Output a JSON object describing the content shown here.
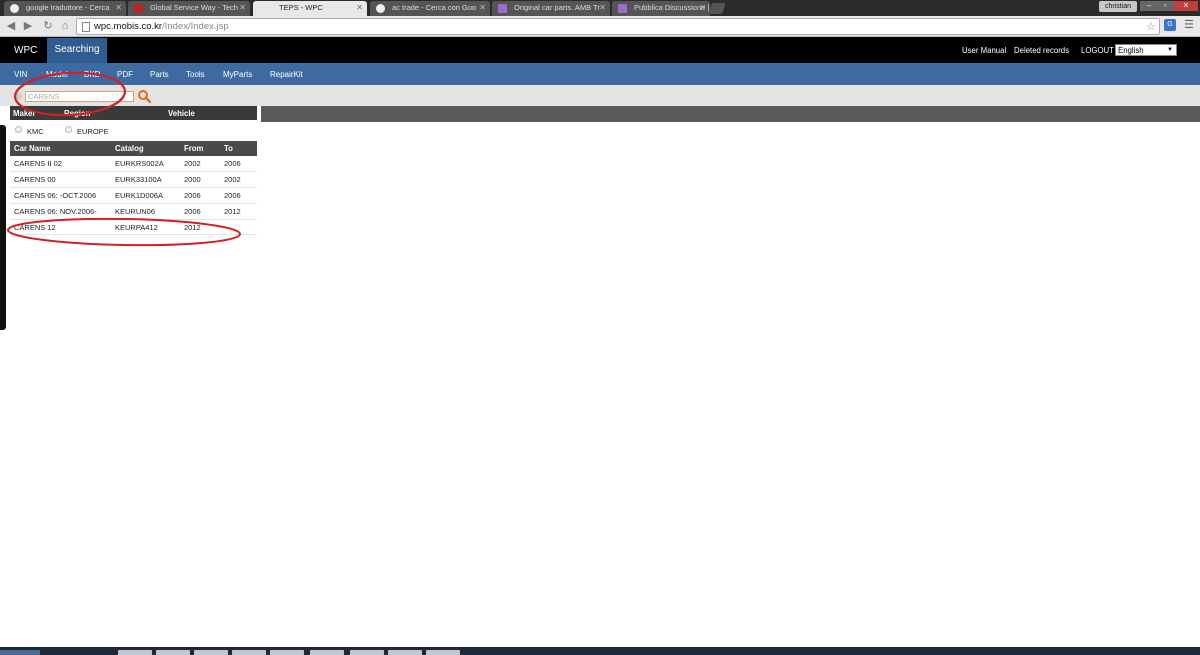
{
  "browser": {
    "tabs": [
      {
        "title": "google traduttore - Cerca",
        "icon": "google-icon",
        "active": false
      },
      {
        "title": "Global Service Way - Tech",
        "icon": "gsw-icon",
        "active": false
      },
      {
        "title": "TEPS - WPC",
        "icon": "",
        "active": true
      },
      {
        "title": "ac trade - Cerca con Goo",
        "icon": "google-icon",
        "active": false
      },
      {
        "title": "Original car parts. AMB Tr",
        "icon": "site-icon",
        "active": false
      },
      {
        "title": "Pubblica Discussione | KIA",
        "icon": "forum-icon",
        "active": false
      }
    ],
    "profile_name": "christian",
    "url_host": "wpc.mobis.co.kr",
    "url_path": "/Index/Index.jsp"
  },
  "app": {
    "brand": "WPC",
    "active_section": "Searching",
    "links": {
      "user_manual": "User Manual",
      "deleted_records": "Deleted records",
      "logout": "LOGOUT"
    },
    "language": "English"
  },
  "menu": {
    "items": [
      "VIN",
      "Model",
      "BKD",
      "PDF",
      "Parts",
      "Tools",
      "MyParts",
      "RepairKit"
    ]
  },
  "search": {
    "value": "CARENS"
  },
  "left_panel": {
    "headers": [
      "Maker",
      "Region",
      "Vehicle"
    ],
    "radios": [
      "KMC",
      "EUROPE"
    ]
  },
  "car_table": {
    "columns": [
      "Car Name",
      "Catalog",
      "From",
      "To"
    ],
    "rows": [
      [
        "CARENS II 02",
        "EURKRS002A",
        "2002",
        "2006"
      ],
      [
        "CARENS 00",
        "EURK33100A",
        "2000",
        "2002"
      ],
      [
        "CARENS 06: -OCT.2006",
        "EURK1D006A",
        "2006",
        "2006"
      ],
      [
        "CARENS 06: NOV.2006-",
        "KEURUN06",
        "2006",
        "2012"
      ],
      [
        "CARENS 12",
        "KEURPA412",
        "2012",
        ""
      ]
    ]
  },
  "colors": {
    "menu_blue": "#3e69a1",
    "active_tab_blue": "#2f5c91",
    "annotation_red": "#d42020",
    "search_icon_orange": "#e86a1c"
  }
}
